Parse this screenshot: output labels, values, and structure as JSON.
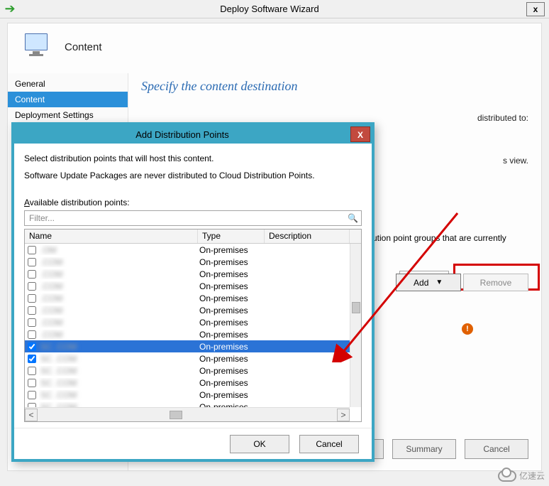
{
  "window": {
    "title": "Deploy Software Wizard",
    "close_symbol": "x"
  },
  "header": {
    "step_title": "Content"
  },
  "sidebar": {
    "items": [
      {
        "label": "General"
      },
      {
        "label": "Content"
      },
      {
        "label": "Deployment Settings"
      }
    ]
  },
  "main": {
    "heading": "Specify the content destination",
    "distributed_to_label": "distributed to:",
    "view_text": "s view.",
    "groups_text": "ution point groups that are currently",
    "add_button": "Add",
    "remove_button": "Remove",
    "footer_next": "",
    "footer_summary": "Summary",
    "footer_cancel": "Cancel"
  },
  "modal": {
    "title": "Add Distribution Points",
    "close_symbol": "X",
    "line1": "Select distribution points that will host this content.",
    "line2": "Software Update Packages are never distributed to Cloud Distribution Points.",
    "available_label_pre": "A",
    "available_label": "vailable distribution points:",
    "filter_placeholder": "Filter...",
    "columns": {
      "name": "Name",
      "type": "Type",
      "desc": "Description"
    },
    "rows": [
      {
        "checked": false,
        "name": "              .OM",
        "type": "On-premises",
        "selected": false
      },
      {
        "checked": false,
        "name": "              .COM",
        "type": "On-premises",
        "selected": false
      },
      {
        "checked": false,
        "name": "              .COM",
        "type": "On-premises",
        "selected": false
      },
      {
        "checked": false,
        "name": "              .COM",
        "type": "On-premises",
        "selected": false
      },
      {
        "checked": false,
        "name": "              .COM",
        "type": "On-premises",
        "selected": false
      },
      {
        "checked": false,
        "name": "              .COM",
        "type": "On-premises",
        "selected": false
      },
      {
        "checked": false,
        "name": "              .COM",
        "type": "On-premises",
        "selected": false
      },
      {
        "checked": false,
        "name": "              .COM",
        "type": "On-premises",
        "selected": false
      },
      {
        "checked": true,
        "name": "SC            .COM",
        "type": "On-premises",
        "selected": true
      },
      {
        "checked": true,
        "name": "SC            .COM",
        "type": "On-premises",
        "selected": false
      },
      {
        "checked": false,
        "name": "SC            .COM",
        "type": "On-premises",
        "selected": false
      },
      {
        "checked": false,
        "name": "SC            .COM",
        "type": "On-premises",
        "selected": false
      },
      {
        "checked": false,
        "name": "SC            .COM",
        "type": "On-premises",
        "selected": false
      },
      {
        "checked": false,
        "name": "SC            .COM",
        "type": "On-premises",
        "selected": false
      }
    ],
    "ok": "OK",
    "cancel": "Cancel"
  },
  "watermark": {
    "text": "亿速云"
  },
  "icons": {
    "arrow_right": "➔",
    "magnifier": "🔍",
    "caret_down": "▼",
    "chevron_left": "<",
    "chevron_right": ">",
    "warning": "!"
  }
}
